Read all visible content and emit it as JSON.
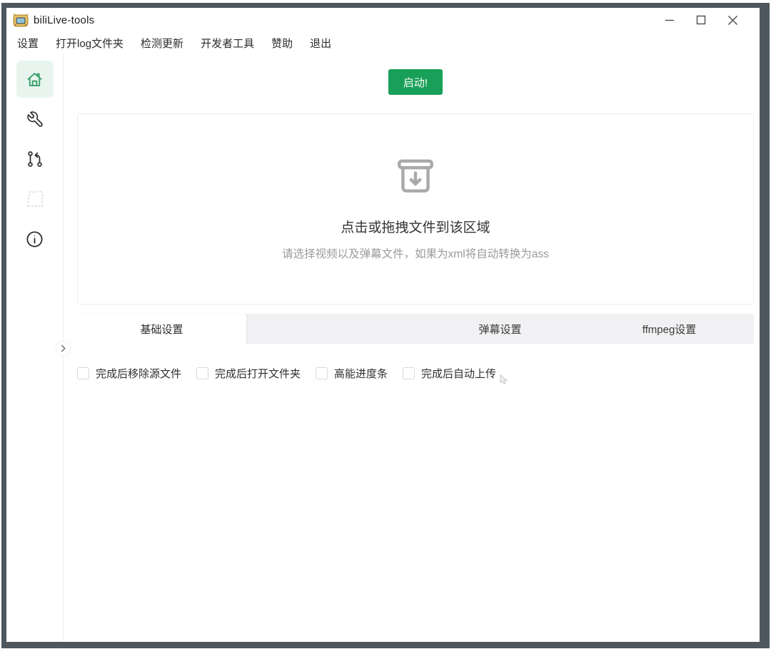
{
  "window": {
    "title": "biliLive-tools",
    "controls": [
      {
        "name": "minimize"
      },
      {
        "name": "maximize"
      },
      {
        "name": "close"
      }
    ]
  },
  "menu": {
    "items": [
      "设置",
      "打开log文件夹",
      "检测更新",
      "开发者工具",
      "赞助",
      "退出"
    ]
  },
  "sidebar": {
    "items": [
      {
        "icon": "home-icon",
        "active": true,
        "disabled": false
      },
      {
        "icon": "wrench-icon",
        "active": false,
        "disabled": false
      },
      {
        "icon": "git-pull-request-icon",
        "active": false,
        "disabled": false
      },
      {
        "icon": "clip-dashed-icon",
        "active": false,
        "disabled": true
      },
      {
        "icon": "info-icon",
        "active": false,
        "disabled": false
      }
    ]
  },
  "main": {
    "start_button_label": "启动!",
    "dropzone": {
      "title": "点击或拖拽文件到该区域",
      "subtitle": "请选择视频以及弹幕文件，如果为xml将自动转换为ass"
    },
    "tabs": [
      {
        "label": "基础设置",
        "active": true
      },
      {
        "label": "弹幕设置",
        "active": false
      },
      {
        "label": "ffmpeg设置",
        "active": false
      }
    ],
    "options": [
      {
        "label": "完成后移除源文件",
        "checked": false
      },
      {
        "label": "完成后打开文件夹",
        "checked": false
      },
      {
        "label": "高能进度条",
        "checked": false
      },
      {
        "label": "完成后自动上传",
        "checked": false
      }
    ]
  },
  "colors": {
    "accent_green": "#18a058",
    "sidebar_active_bg": "#e7f5ee",
    "window_frame": "#4d575d",
    "tabbar_bg": "#f1f1f3"
  }
}
